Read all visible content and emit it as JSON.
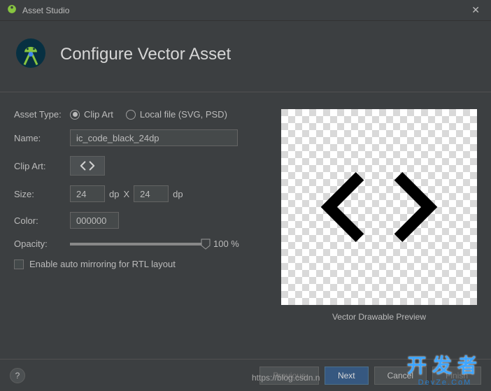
{
  "window": {
    "title": "Asset Studio"
  },
  "header": {
    "title": "Configure Vector Asset"
  },
  "form": {
    "assetTypeLabel": "Asset Type:",
    "radioClipArt": "Clip Art",
    "radioLocalFile": "Local file (SVG, PSD)",
    "nameLabel": "Name:",
    "nameValue": "ic_code_black_24dp",
    "clipArtLabel": "Clip Art:",
    "sizeLabel": "Size:",
    "sizeWidth": "24",
    "sizeHeight": "24",
    "sizeUnit": "dp",
    "sizeX": "X",
    "colorLabel": "Color:",
    "colorValue": "000000",
    "opacityLabel": "Opacity:",
    "opacityValue": "100 %",
    "rtlLabel": "Enable auto mirroring for RTL layout"
  },
  "preview": {
    "label": "Vector Drawable Preview"
  },
  "footer": {
    "help": "?",
    "previous": "Previous",
    "next": "Next",
    "cancel": "Cancel",
    "finish": "Finish"
  },
  "watermark": {
    "url": "https://blog.csdn.n",
    "cn": "开发者",
    "en": "DevZe.CoM"
  }
}
